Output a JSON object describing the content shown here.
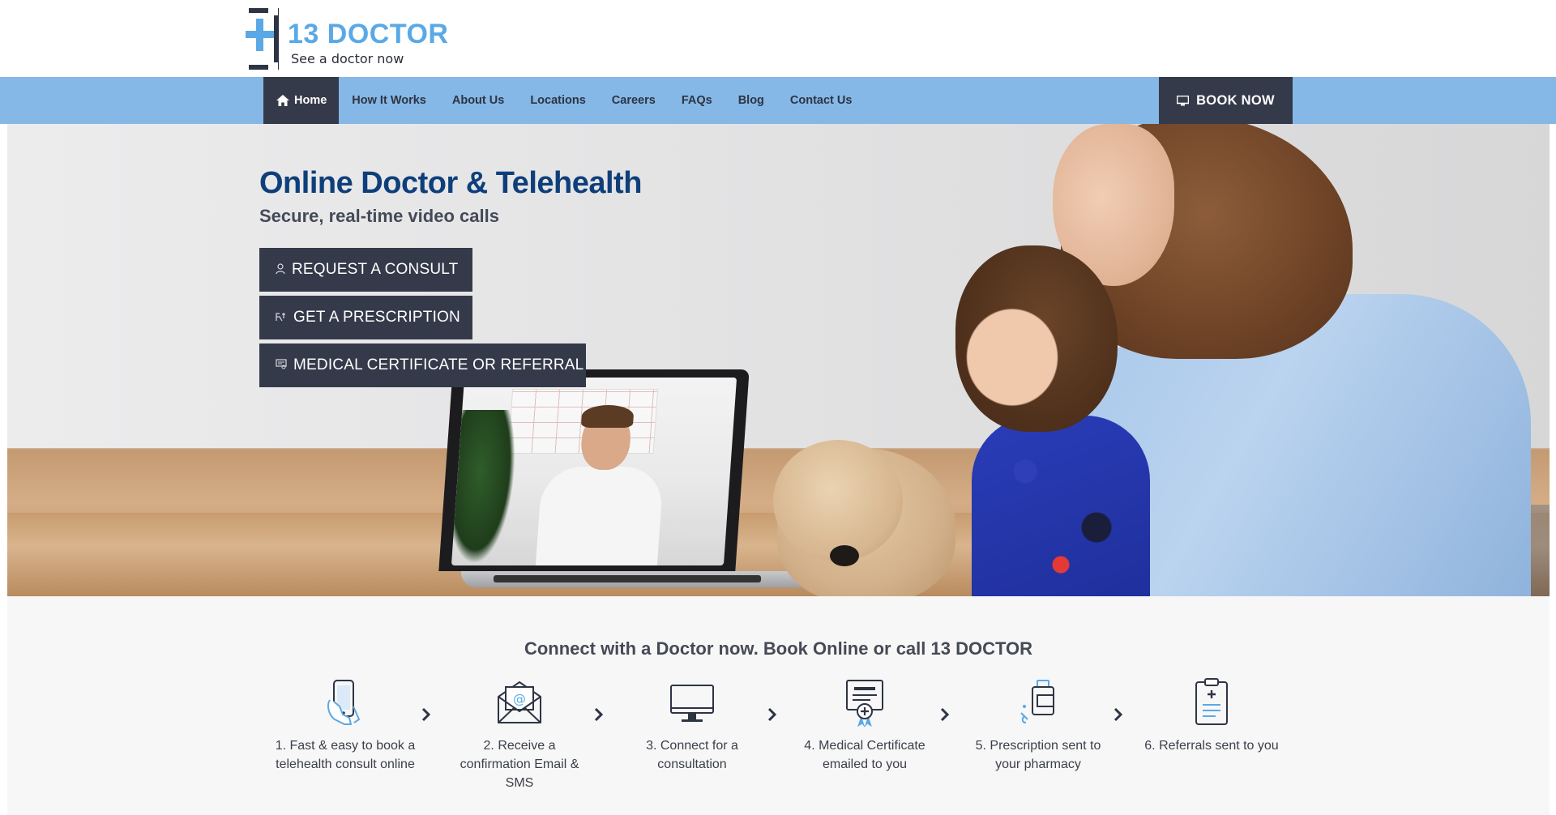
{
  "header": {
    "logo_name": "13 DOCTOR",
    "logo_tagline": "See a doctor now",
    "brand_color": "#5aa9e6"
  },
  "nav": {
    "items": [
      {
        "label": "Home",
        "icon": "home-icon",
        "active": true
      },
      {
        "label": "How It Works"
      },
      {
        "label": "About Us"
      },
      {
        "label": "Locations"
      },
      {
        "label": "Careers"
      },
      {
        "label": "FAQs"
      },
      {
        "label": "Blog"
      },
      {
        "label": "Contact Us"
      }
    ],
    "book_now": {
      "label": "BOOK NOW",
      "icon": "monitor-icon"
    },
    "bar_color": "#85b8e6",
    "dark_color": "#353a4a"
  },
  "hero": {
    "title": "Online Doctor & Telehealth",
    "subtitle": "Secure, real-time video calls",
    "buttons": [
      {
        "label": "REQUEST A CONSULT",
        "icon": "doctor-icon"
      },
      {
        "label": "GET A PRESCRIPTION",
        "icon": "prescription-icon"
      },
      {
        "label": "MEDICAL CERTIFICATE OR REFERRAL",
        "icon": "certificate-icon"
      }
    ],
    "title_color": "#0e3f7a"
  },
  "steps": {
    "heading": "Connect with a Doctor now. Book Online or call 13 DOCTOR",
    "items": [
      {
        "label": "1. Fast & easy to book a telehealth consult online",
        "icon": "phone-hand-icon"
      },
      {
        "label": "2. Receive a confirmation Email & SMS",
        "icon": "email-icon"
      },
      {
        "label": "3. Connect for a consultation",
        "icon": "monitor-icon"
      },
      {
        "label": "4. Medical Certificate emailed to you",
        "icon": "certificate-icon"
      },
      {
        "label": "5. Prescription sent to your pharmacy",
        "icon": "pill-bottle-icon"
      },
      {
        "label": "6. Referrals sent to you",
        "icon": "clipboard-icon"
      }
    ],
    "separator_icon": "chevron-right-icon"
  }
}
